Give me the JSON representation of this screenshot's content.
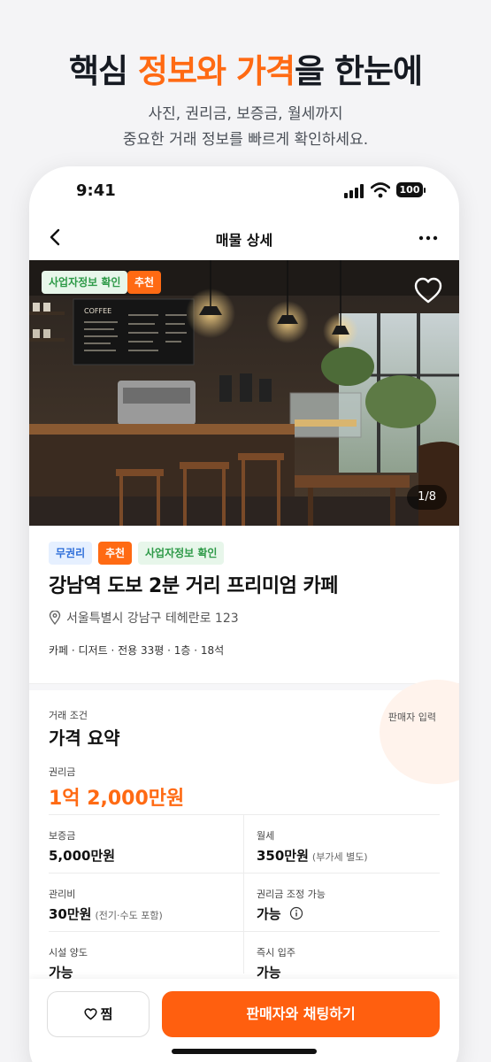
{
  "promo": {
    "headline_pre": "핵심 ",
    "headline_accent": "정보와 가격",
    "headline_post": "을 한눈에",
    "subline1": "사진, 권리금, 보증금, 월세까지",
    "subline2": "중요한 거래 정보를 빠르게 확인하세요."
  },
  "status_bar": {
    "time": "9:41",
    "battery": "100"
  },
  "nav": {
    "title": "매물 상세",
    "back_icon": "chevron-left-icon",
    "more_icon": "more-horizontal-icon"
  },
  "hero": {
    "badges": [
      "사업자정보 확인",
      "추천"
    ],
    "photo_counter": "1/8",
    "menu_board_text": "COFFEE"
  },
  "listing": {
    "tags": [
      "무권리",
      "추천",
      "사업자정보 확인"
    ],
    "title": "강남역 도보 2분 거리 프리미엄 카페",
    "address": "서울특별시 강남구 테헤란로 123",
    "meta": "카페  ·  디저트  ·  전용 33평  ·  1층  ·  18석"
  },
  "pricing": {
    "section_label": "거래 조건",
    "section_title": "가격 요약",
    "seller_input": "판매자 입력",
    "premium_label": "권리금",
    "premium_value": "1억 2,000만원",
    "deposit_label": "보증금",
    "deposit_value": "5,000만원",
    "rent_label": "월세",
    "rent_value": "350만원",
    "rent_note": "(부가세 별도)",
    "mgmt_label": "관리비",
    "mgmt_value": "30만원",
    "mgmt_note": "(전기·수도 포함)",
    "negotiable_label": "권리금 조정 가능",
    "negotiable_value": "가능",
    "facility_label": "시설 양도",
    "facility_value": "가능",
    "movein_label": "즉시 입주",
    "movein_value": "가능"
  },
  "actions": {
    "zzim": "찜",
    "chat": "판매자와 채팅하기"
  },
  "colors": {
    "accent": "#ff6a13",
    "verified_green": "#2e9a48",
    "tag_blue": "#2f6fd9"
  }
}
